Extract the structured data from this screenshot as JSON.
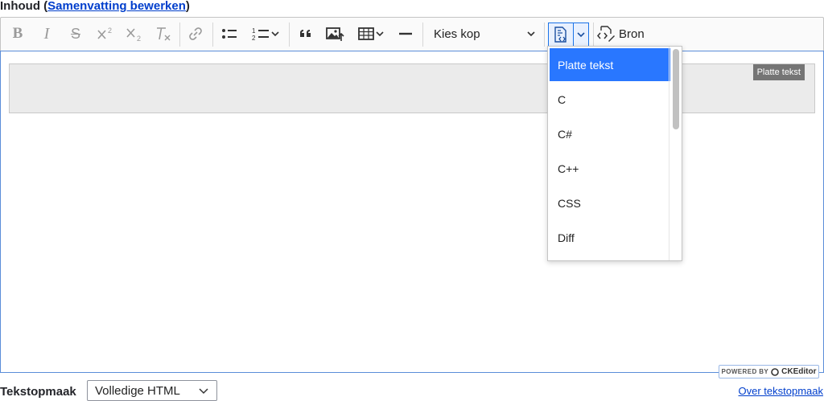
{
  "field": {
    "label": "Inhoud",
    "paren_open": " (",
    "summary_link": "Samenvatting bewerken",
    "paren_close": ")"
  },
  "toolbar": {
    "bold": "B",
    "italic": "I",
    "strike": "S",
    "heading_select": "Kies kop",
    "source_label": "Bron"
  },
  "code_block": {
    "language_badge": "Platte tekst"
  },
  "language_dropdown": {
    "items": [
      {
        "label": "Platte tekst",
        "selected": true
      },
      {
        "label": "C",
        "selected": false
      },
      {
        "label": "C#",
        "selected": false
      },
      {
        "label": "C++",
        "selected": false
      },
      {
        "label": "CSS",
        "selected": false
      },
      {
        "label": "Diff",
        "selected": false
      }
    ]
  },
  "powered_by": {
    "prefix": "POWERED BY",
    "brand": "CKEditor"
  },
  "text_format": {
    "label": "Tekstopmaak",
    "selected": "Volledige HTML",
    "about_link": "Over tekstopmaak"
  },
  "colors": {
    "accent": "#2977ff",
    "link": "#003ecc",
    "focus_border": "#5b8dd9"
  }
}
